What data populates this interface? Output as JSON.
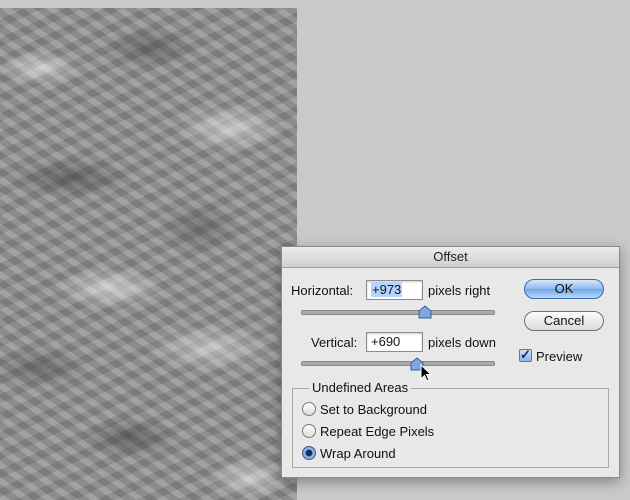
{
  "dialog": {
    "title": "Offset",
    "horizontal": {
      "label": "Horizontal:",
      "value": "+973",
      "unit": "pixels right"
    },
    "vertical": {
      "label": "Vertical:",
      "value": "+690",
      "unit": "pixels down"
    },
    "ok_label": "OK",
    "cancel_label": "Cancel",
    "preview": {
      "label": "Preview",
      "checked": true
    },
    "undefined_areas": {
      "title": "Undefined Areas",
      "options": [
        {
          "label": "Set to Background",
          "selected": false
        },
        {
          "label": "Repeat Edge Pixels",
          "selected": false
        },
        {
          "label": "Wrap Around",
          "selected": true
        }
      ]
    }
  },
  "colors": {
    "accent": "#6fa6ea",
    "dialog_bg": "#e8e8e8",
    "canvas_bg": "#c9c9c9"
  },
  "icons": [
    "slider-thumb-icon",
    "checkmark-icon",
    "mouse-pointer-icon"
  ]
}
